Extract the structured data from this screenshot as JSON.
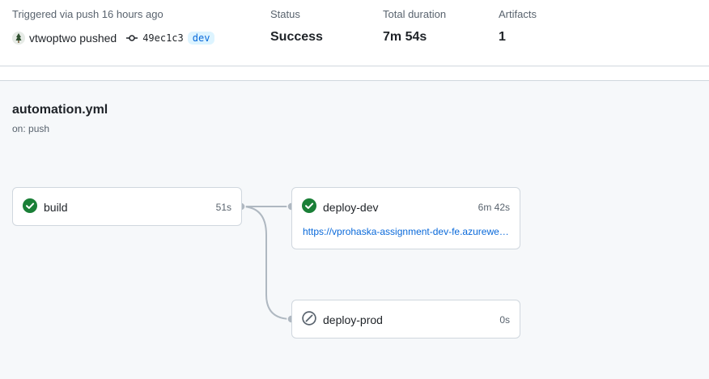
{
  "summary": {
    "trigger_text": "Triggered via push 16 hours ago",
    "actor": "vtwoptwo pushed",
    "commit_sha": "49ec1c3",
    "branch": "dev",
    "status_label": "Status",
    "status_value": "Success",
    "duration_label": "Total duration",
    "duration_value": "7m 54s",
    "artifacts_label": "Artifacts",
    "artifacts_value": "1"
  },
  "workflow": {
    "file": "automation.yml",
    "trigger": "on: push"
  },
  "jobs": {
    "build": {
      "name": "build",
      "duration": "51s",
      "status": "success"
    },
    "deploy_dev": {
      "name": "deploy-dev",
      "duration": "6m 42s",
      "status": "success",
      "link": "https://vprohaska-assignment-dev-fe.azurewebsites.net"
    },
    "deploy_prod": {
      "name": "deploy-prod",
      "duration": "0s",
      "status": "skipped"
    }
  },
  "icons": {
    "success": "check-circle-fill-icon",
    "skipped": "skip-icon",
    "commit": "git-commit-icon"
  },
  "colors": {
    "success": "#1a7f37",
    "link": "#0969da",
    "muted": "#59636e",
    "connector": "#afb8c1"
  }
}
